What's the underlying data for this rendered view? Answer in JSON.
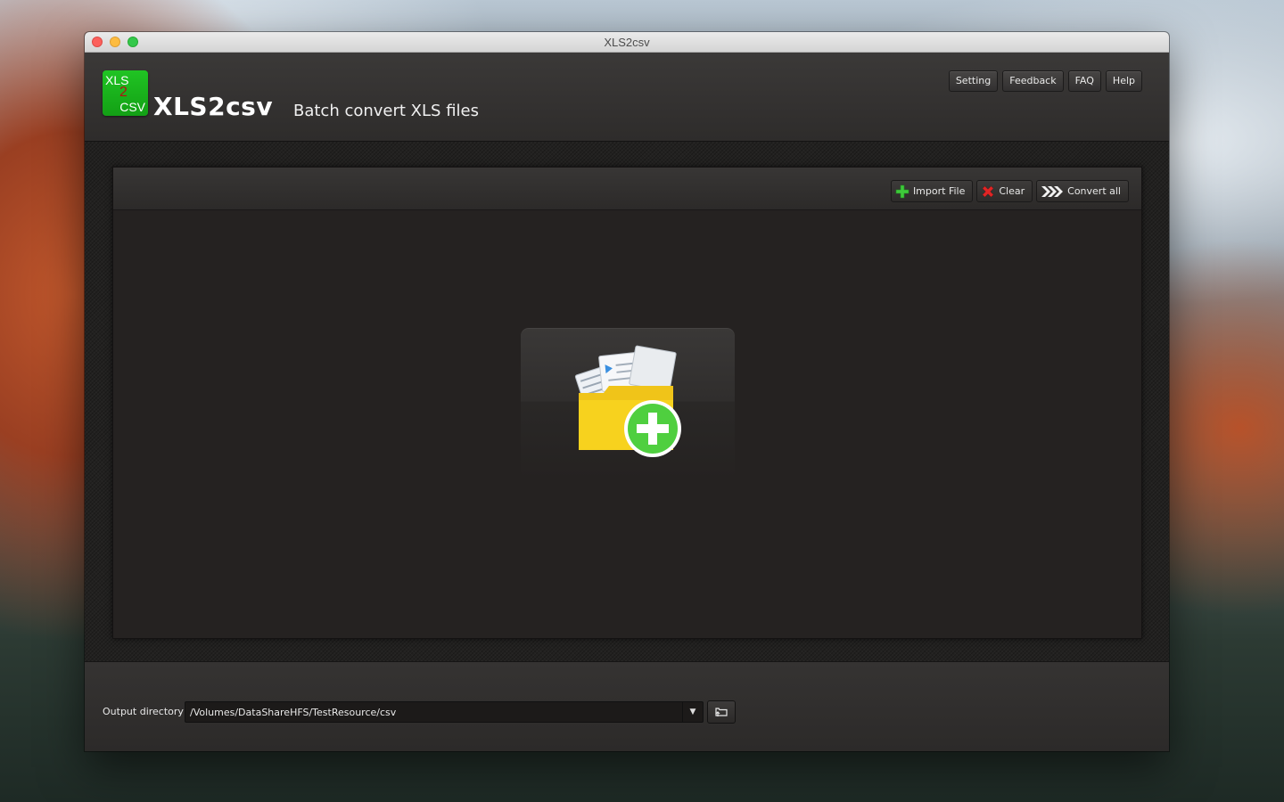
{
  "window": {
    "title": "XLS2csv"
  },
  "header": {
    "logo_line1": "XLS",
    "logo_line2": "2",
    "logo_line3": "CSV",
    "app_name": "XLS2csv",
    "tagline": "Batch convert XLS files",
    "nav_buttons": [
      "Setting",
      "Feedback",
      "FAQ",
      "Help"
    ]
  },
  "toolbar": {
    "import_label": "Import File",
    "clear_label": "Clear",
    "convert_label": "Convert all"
  },
  "drop_zone": {
    "icon": "folder-add-icon"
  },
  "output": {
    "label": "Output directory",
    "path": "/Volumes/DataShareHFS/TestResource/csv"
  },
  "colors": {
    "accent_green": "#1fbf22",
    "clear_red": "#e02626",
    "folder_yellow": "#f7d21e",
    "plus_green": "#4fcf3f"
  }
}
